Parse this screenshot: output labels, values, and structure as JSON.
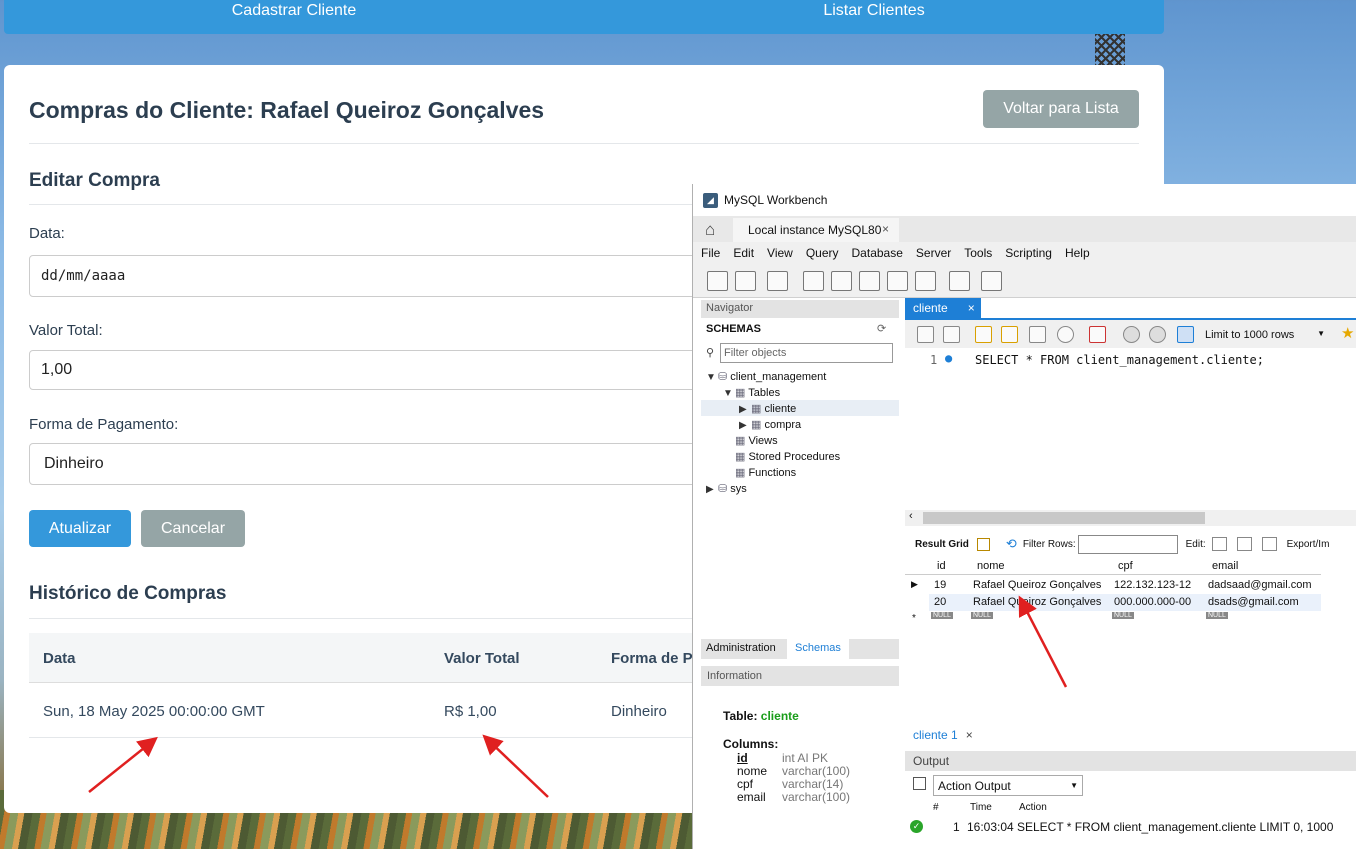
{
  "nav": {
    "items": [
      {
        "label": "Cadastrar Cliente"
      },
      {
        "label": "Listar Clientes"
      }
    ]
  },
  "page": {
    "title": "Compras do Cliente: Rafael Queiroz Gonçalves",
    "back_button": "Voltar para Lista",
    "edit": {
      "title": "Editar Compra",
      "date_label": "Data:",
      "date_placeholder": "dd/mm/aaaa",
      "total_label": "Valor Total:",
      "total_value": "1,00",
      "payment_label": "Forma de Pagamento:",
      "payment_value": "Dinheiro",
      "update_button": "Atualizar",
      "cancel_button": "Cancelar"
    },
    "history": {
      "title": "Histórico de Compras",
      "columns": [
        "Data",
        "Valor Total",
        "Forma de P"
      ],
      "rows": [
        {
          "date": "Sun, 18 May 2025 00:00:00 GMT",
          "total": "R$ 1,00",
          "payment": "Dinheiro"
        }
      ]
    }
  },
  "workbench": {
    "window_title": "MySQL Workbench",
    "connection_tab": "Local instance MySQL80",
    "menu": [
      "File",
      "Edit",
      "View",
      "Query",
      "Database",
      "Server",
      "Tools",
      "Scripting",
      "Help"
    ],
    "navigator": {
      "header": "Navigator",
      "schemas_label": "SCHEMAS",
      "filter_placeholder": "Filter objects",
      "schema": "client_management",
      "tables_label": "Tables",
      "tables": [
        "cliente",
        "compra"
      ],
      "others": [
        "Views",
        "Stored Procedures",
        "Functions"
      ],
      "sys": "sys",
      "tabs": [
        "Administration",
        "Schemas"
      ]
    },
    "information": {
      "header": "Information",
      "table_label": "Table:",
      "table_name": "cliente",
      "columns_label": "Columns:",
      "columns": [
        {
          "name": "id",
          "type": "int AI PK"
        },
        {
          "name": "nome",
          "type": "varchar(100)"
        },
        {
          "name": "cpf",
          "type": "varchar(14)"
        },
        {
          "name": "email",
          "type": "varchar(100)"
        }
      ]
    },
    "query_tab": "cliente",
    "limit": "Limit to 1000 rows",
    "editor": {
      "line": "1",
      "sql": "SELECT * FROM client_management.cliente;"
    },
    "result": {
      "grid_label": "Result Grid",
      "filter_label": "Filter Rows:",
      "edit_label": "Edit:",
      "export_label": "Export/Im",
      "columns": [
        "id",
        "nome",
        "cpf",
        "email"
      ],
      "rows": [
        {
          "id": "19",
          "nome": "Rafael Queiroz Gonçalves",
          "cpf": "122.132.123-12",
          "email": "dadsaad@gmail.com"
        },
        {
          "id": "20",
          "nome": "Rafael Queiroz Gonçalves",
          "cpf": "000.000.000-00",
          "email": "dsads@gmail.com"
        }
      ],
      "null_text": "NULL"
    },
    "result_tab": "cliente 1",
    "output": {
      "header": "Output",
      "selector": "Action Output",
      "columns": [
        "#",
        "Time",
        "Action"
      ],
      "entry": {
        "num": "1",
        "time": "16:03:04",
        "action": "SELECT * FROM client_management.cliente LIMIT 0, 1000"
      }
    }
  }
}
